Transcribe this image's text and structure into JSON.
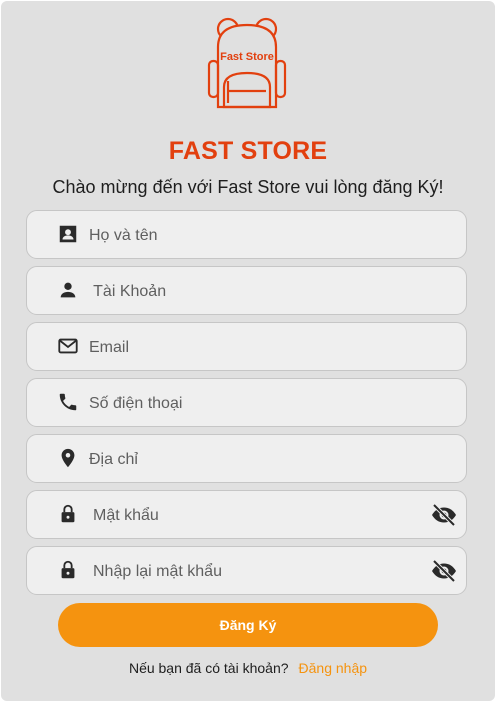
{
  "brand": {
    "logo_text": "Fast Store",
    "name": "FAST STORE",
    "welcome": "Chào mừng đến với Fast Store vui lòng đăng Ký!",
    "color": "#e2400f"
  },
  "form": {
    "fields": [
      {
        "placeholder": "Họ và tên",
        "icon": "contact-card-icon"
      },
      {
        "placeholder": " Tài Khoản",
        "icon": "person-icon"
      },
      {
        "placeholder": "Email",
        "icon": "mail-icon"
      },
      {
        "placeholder": "Số điện thoại",
        "icon": "phone-icon"
      },
      {
        "placeholder": "Địa chỉ",
        "icon": "location-pin-icon"
      },
      {
        "placeholder": "Mật khẩu",
        "icon": "lock-icon",
        "toggle_icon": "eye-off-icon"
      },
      {
        "placeholder": "Nhập lại mật khẩu",
        "icon": "lock-icon",
        "toggle_icon": "eye-off-icon"
      }
    ],
    "submit_label": "Đăng Ký",
    "accent_color": "#f5930f"
  },
  "footer": {
    "question": "Nếu bạn đã có tài khoản?",
    "login_link": "Đăng nhập"
  }
}
